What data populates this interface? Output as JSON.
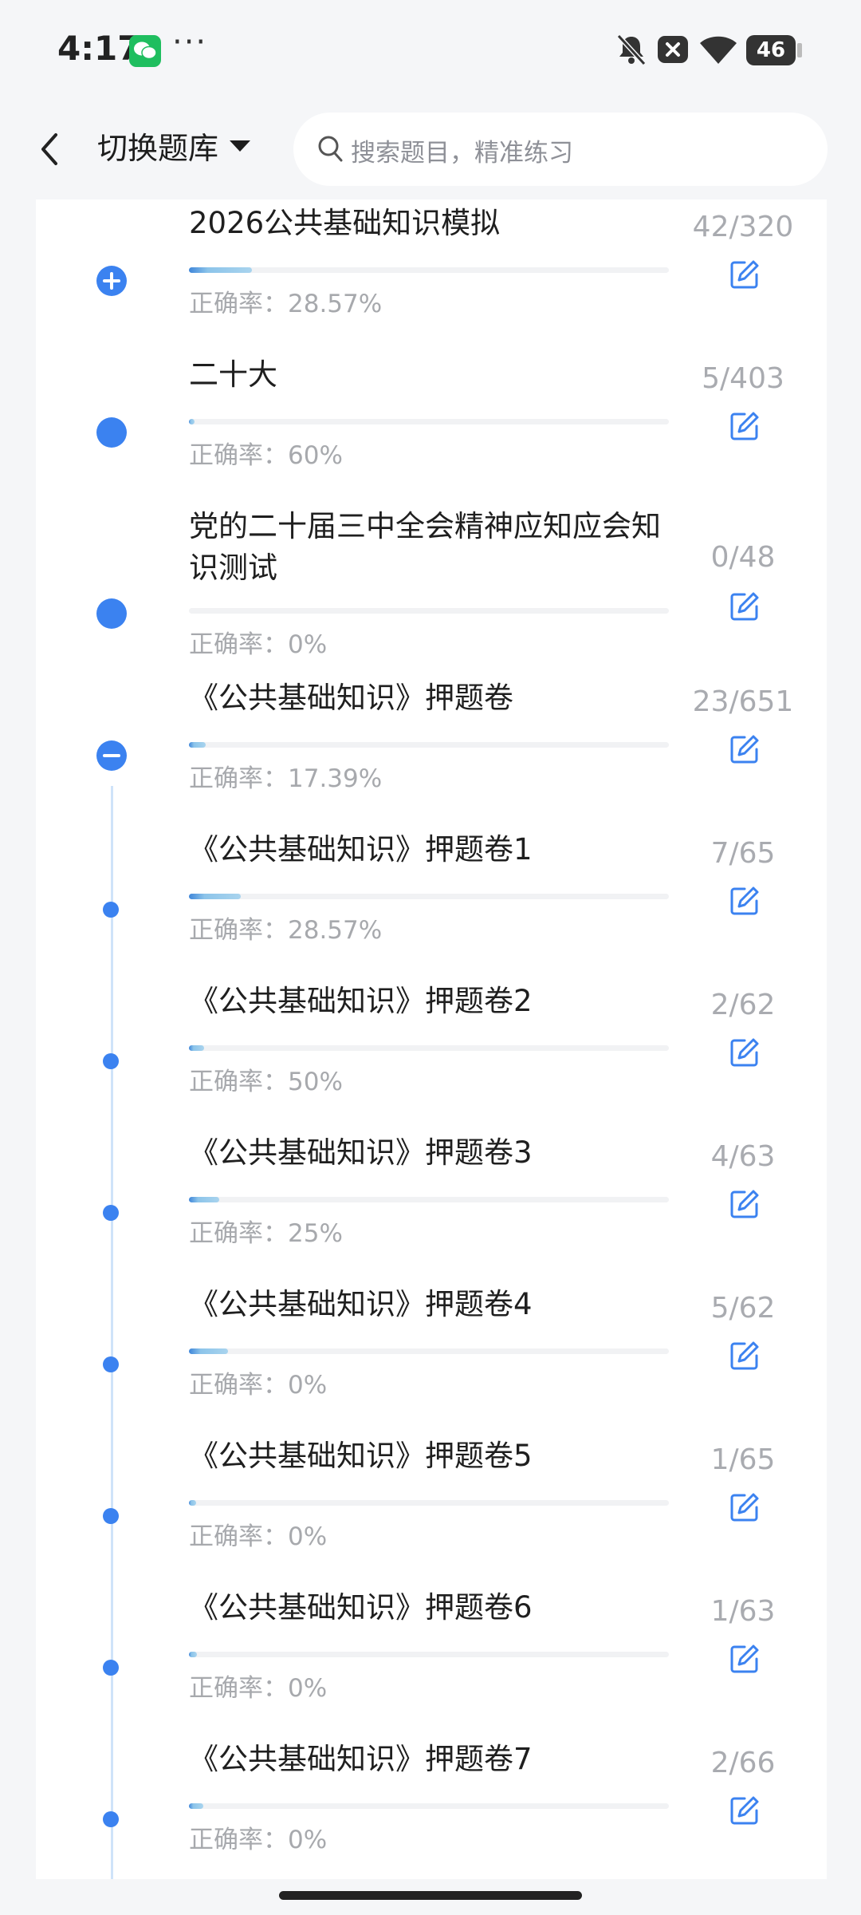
{
  "status_bar": {
    "time": "4:17",
    "more_dots": "···",
    "battery": "46",
    "icons": [
      "wechat-icon",
      "bell-off-icon",
      "close-badge-icon",
      "wifi-icon",
      "battery-icon"
    ]
  },
  "header": {
    "back_icon": "chevron-left-icon",
    "bank_label": "切换题库",
    "search_placeholder": "搜索题目，精准练习"
  },
  "colors": {
    "accent": "#3b82f0",
    "muted": "#a7a9ad",
    "bg": "#f5f6f8"
  },
  "items": [
    {
      "title": "2026公共基础知识模拟",
      "accuracy": "正确率：28.57%",
      "count": "42/320",
      "progress": 0.131,
      "marker": "expand-plus"
    },
    {
      "title": "二十大",
      "accuracy": "正确率：60%",
      "count": "5/403",
      "progress": 0.012,
      "marker": "dot"
    },
    {
      "title": "党的二十届三中全会精神应知应会知识测试",
      "accuracy": "正确率：0%",
      "count": "0/48",
      "progress": 0,
      "marker": "dot"
    },
    {
      "title": "《公共基础知识》押题卷",
      "accuracy": "正确率：17.39%",
      "count": "23/651",
      "progress": 0.035,
      "marker": "collapse-minus"
    },
    {
      "title": "《公共基础知识》押题卷1",
      "accuracy": "正确率：28.57%",
      "count": "7/65",
      "progress": 0.108,
      "marker": "small-dot"
    },
    {
      "title": "《公共基础知识》押题卷2",
      "accuracy": "正确率：50%",
      "count": "2/62",
      "progress": 0.032,
      "marker": "small-dot"
    },
    {
      "title": "《公共基础知识》押题卷3",
      "accuracy": "正确率：25%",
      "count": "4/63",
      "progress": 0.063,
      "marker": "small-dot"
    },
    {
      "title": "《公共基础知识》押题卷4",
      "accuracy": "正确率：0%",
      "count": "5/62",
      "progress": 0.081,
      "marker": "small-dot"
    },
    {
      "title": "《公共基础知识》押题卷5",
      "accuracy": "正确率：0%",
      "count": "1/65",
      "progress": 0.015,
      "marker": "small-dot"
    },
    {
      "title": "《公共基础知识》押题卷6",
      "accuracy": "正确率：0%",
      "count": "1/63",
      "progress": 0.016,
      "marker": "small-dot"
    },
    {
      "title": "《公共基础知识》押题卷7",
      "accuracy": "正确率：0%",
      "count": "2/66",
      "progress": 0.03,
      "marker": "small-dot"
    }
  ]
}
